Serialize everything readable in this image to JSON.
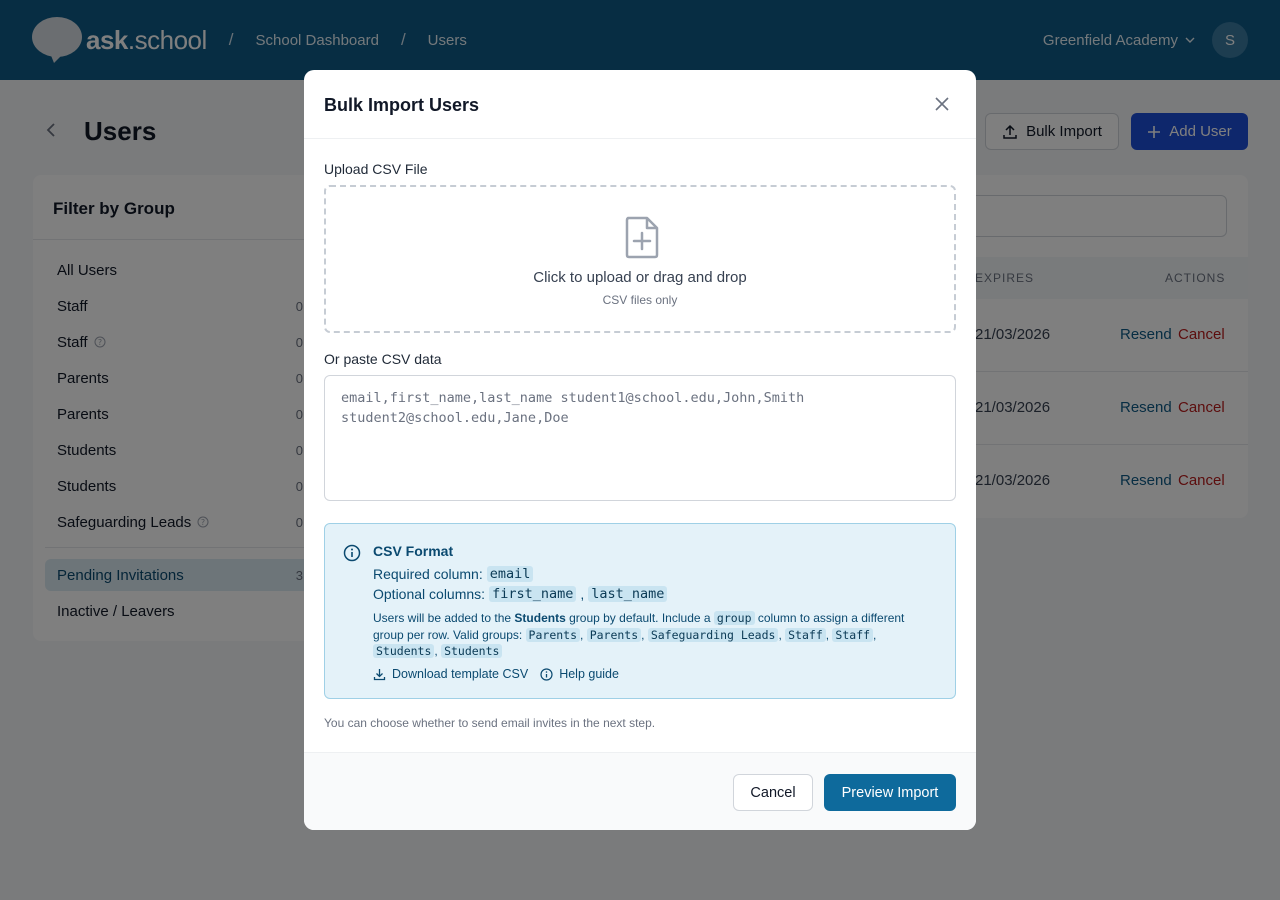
{
  "header": {
    "logo": {
      "main": "ask",
      "sub": ".school"
    },
    "breadcrumbs": [
      "School Dashboard",
      "Users"
    ],
    "school": "Greenfield Academy",
    "avatar_initial": "S"
  },
  "page": {
    "title": "Users",
    "bulk_import_label": "Bulk Import",
    "add_user_label": "Add User"
  },
  "filter": {
    "title": "Filter by Group",
    "items": [
      {
        "label": "All Users",
        "count": ""
      },
      {
        "label": "Staff",
        "count": "0"
      },
      {
        "label": "Staff",
        "count": "0",
        "help": true
      },
      {
        "label": "Parents",
        "count": "0"
      },
      {
        "label": "Parents",
        "count": "0"
      },
      {
        "label": "Students",
        "count": "0"
      },
      {
        "label": "Students",
        "count": "0"
      },
      {
        "label": "Safeguarding Leads",
        "count": "0",
        "help": true
      }
    ],
    "pending": {
      "label": "Pending Invitations",
      "count": "3"
    },
    "inactive": {
      "label": "Inactive / Leavers"
    }
  },
  "table": {
    "columns": {
      "expires": "EXPIRES",
      "actions": "ACTIONS"
    },
    "rows": [
      {
        "expires": "21/03/2026",
        "resend": "Resend",
        "cancel": "Cancel"
      },
      {
        "expires": "21/03/2026",
        "resend": "Resend",
        "cancel": "Cancel"
      },
      {
        "expires": "21/03/2026",
        "resend": "Resend",
        "cancel": "Cancel"
      }
    ]
  },
  "modal": {
    "title": "Bulk Import Users",
    "upload_label": "Upload CSV File",
    "dropzone_text": "Click to upload or drag and drop",
    "dropzone_sub": "CSV files only",
    "paste_label": "Or paste CSV data",
    "paste_placeholder": "email,first_name,last_name student1@school.edu,John,Smith\nstudent2@school.edu,Jane,Doe",
    "info": {
      "title": "CSV Format",
      "required_label": "Required column:",
      "required_cols": [
        "email"
      ],
      "optional_label": "Optional columns:",
      "optional_cols": [
        "first_name",
        "last_name"
      ],
      "para_1": "Users will be added to the",
      "para_default_group": "Students",
      "para_2": "group by default. Include a",
      "para_col": "group",
      "para_3": "column to assign a different group per row. Valid groups:",
      "valid_groups": [
        "Parents",
        "Parents",
        "Safeguarding Leads",
        "Staff",
        "Staff",
        "Students",
        "Students"
      ],
      "download_label": "Download template CSV",
      "help_label": "Help guide"
    },
    "footnote": "You can choose whether to send email invites in the next step.",
    "cancel_label": "Cancel",
    "preview_label": "Preview Import"
  }
}
